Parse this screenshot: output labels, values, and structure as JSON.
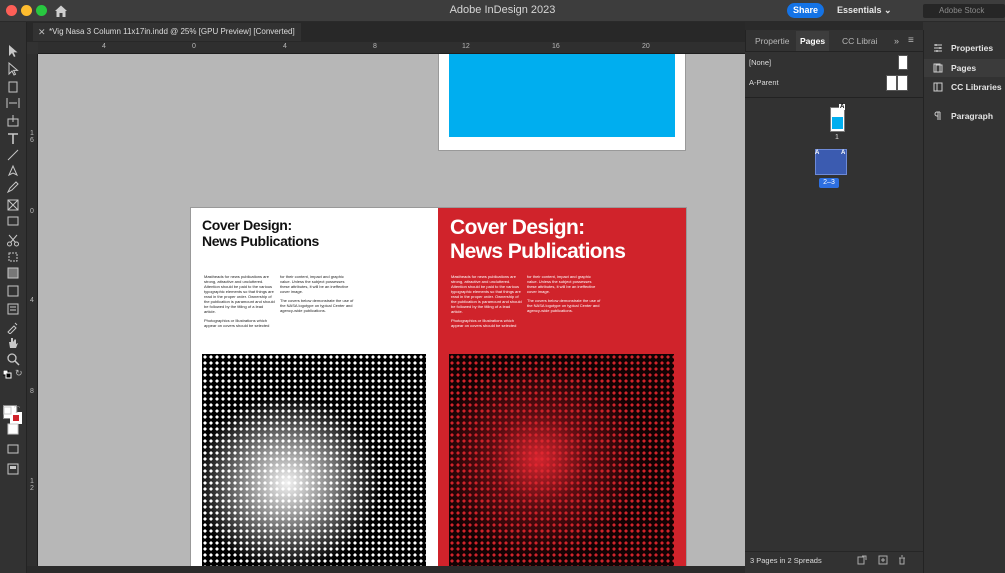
{
  "window": {
    "title": "Adobe InDesign 2023",
    "share_label": "Share",
    "workspace_label": "Essentials",
    "search_placeholder": "Adobe Stock"
  },
  "document_tab": {
    "title": "*Vig Nasa 3 Column 11x17in.indd @ 25% [GPU Preview] [Converted]"
  },
  "rulers": {
    "horizontal_ticks": [
      "4",
      "0",
      "4",
      "8",
      "12",
      "16",
      "20"
    ],
    "vertical_ticks": [
      "1\n6",
      "0",
      "4",
      "8",
      "1\n2"
    ]
  },
  "spread_left": {
    "title_line1": "Cover Design:",
    "title_line2": "News Publications",
    "col1": "Mastheads for news publications are strong, attractive and uncluttered. Attention should be paid to the various typographic elements so that things are read in the proper order. Ownership of the publication is paramount and should be followed by the titling of a lead article.",
    "col1b": "Photographics or Illustrations which appear on covers should be selected",
    "col2": "for their content, impact and graphic value. Unless the subject possesses these attributes, it will be an ineffective cover image.",
    "col2b": "The covers below demonstrate the use of the NASA logotype on typical Center and agency-wide publications."
  },
  "spread_right": {
    "title_line1": "Cover Design:",
    "title_line2": "News Publications",
    "col1": "Mastheads for news publications are strong, attractive and uncluttered. Attention should be paid to the various typographic elements so that things are read in the proper order. Ownership of the publication is paramount and should be followed by the titling of a lead article.",
    "col1b": "Photographics or Illustrations which appear on covers should be selected",
    "col2": "for their content, impact and graphic value. Unless the subject possesses these attributes, it will be an ineffective cover image.",
    "col2b": "The covers below demonstrate the use of the NASA logotype on typical Center and agency-wide publications."
  },
  "panel": {
    "tabs": [
      "Propertie",
      "Pages",
      "CC Librai"
    ],
    "active_tab": "Pages",
    "parents": [
      "[None]",
      "A-Parent"
    ],
    "page1_label": "1",
    "page1_parent": "A",
    "spread2_parent_left": "A",
    "spread2_parent_right": "A",
    "spread2_label": "2–3",
    "footer": "3 Pages in 2 Spreads"
  },
  "dock": {
    "items": [
      "Properties",
      "Pages",
      "CC Libraries",
      "Paragraph"
    ],
    "active": "Pages"
  },
  "colors": {
    "accent": "#1473e6",
    "cover_red": "#d0232b",
    "cyan": "#00aeef"
  }
}
